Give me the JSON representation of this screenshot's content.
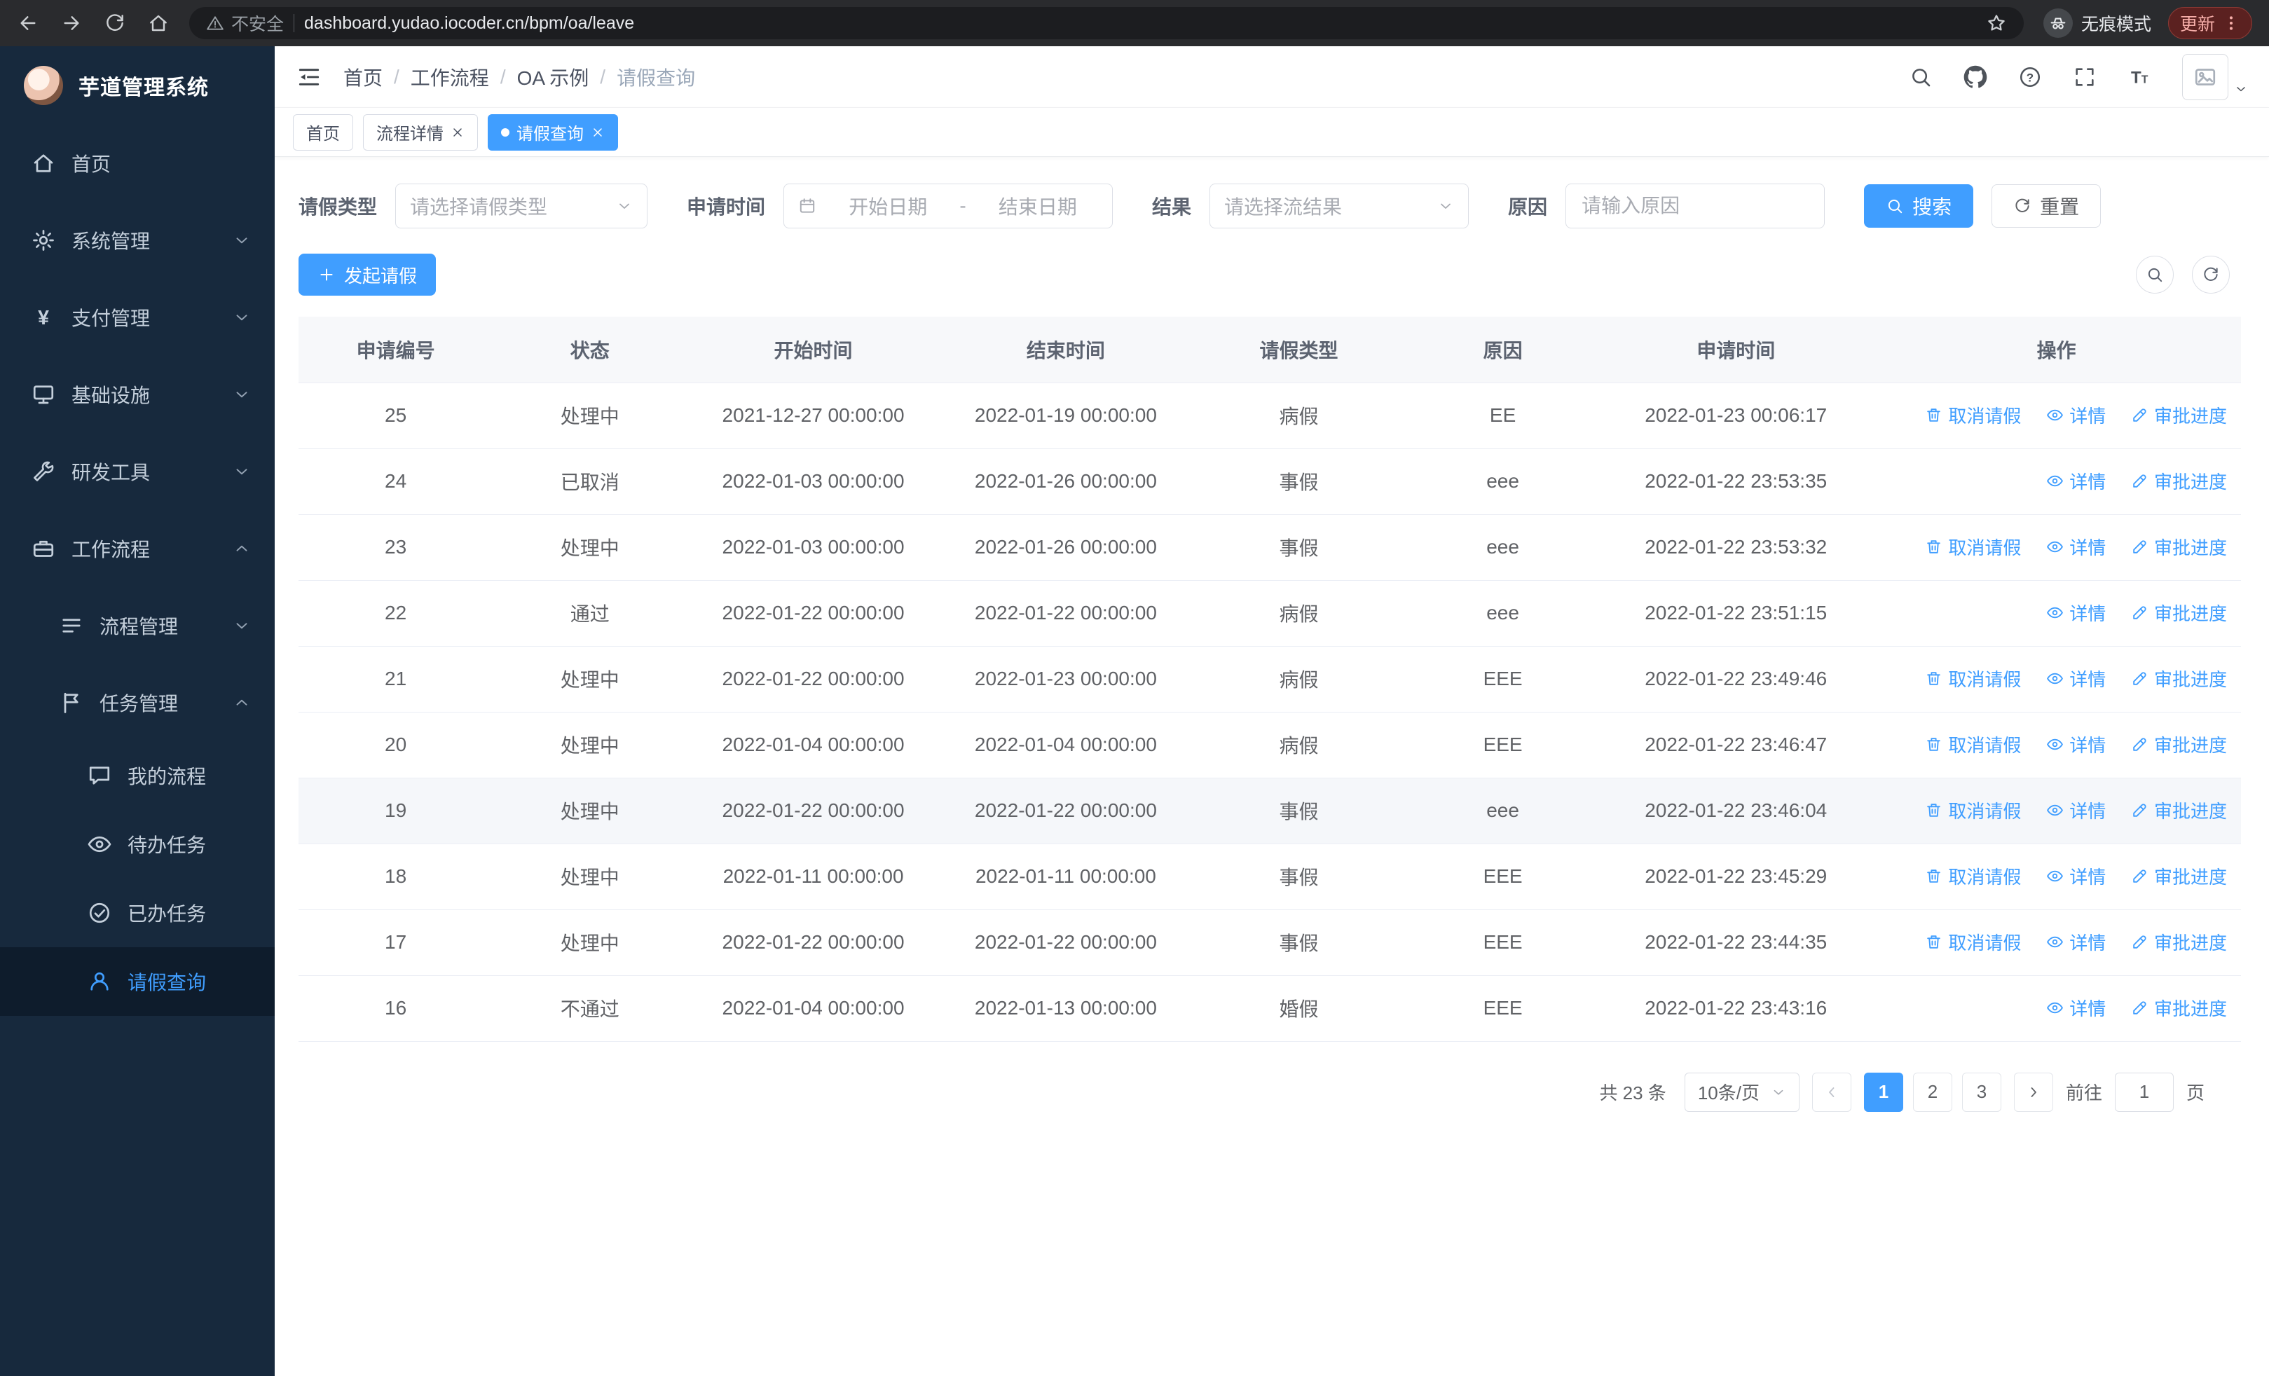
{
  "colors": {
    "primary": "#409eff",
    "sidebar_bg": "#17293d"
  },
  "browser": {
    "security_label": "不安全",
    "url": "dashboard.yudao.iocoder.cn/bpm/oa/leave",
    "incognito_label": "无痕模式",
    "update_label": "更新"
  },
  "sidebar": {
    "logo_title": "芋道管理系统",
    "menu_level1": [
      {
        "label": "首页",
        "icon": "home",
        "has_chevron": false,
        "chevron_up": false,
        "active": false
      },
      {
        "label": "系统管理",
        "icon": "gear",
        "has_chevron": true,
        "chevron_up": false,
        "active": false
      },
      {
        "label": "支付管理",
        "icon": "yen",
        "has_chevron": true,
        "chevron_up": false,
        "active": false
      },
      {
        "label": "基础设施",
        "icon": "infra",
        "has_chevron": true,
        "chevron_up": false,
        "active": false
      },
      {
        "label": "研发工具",
        "icon": "tools",
        "has_chevron": true,
        "chevron_up": false,
        "active": false
      },
      {
        "label": "工作流程",
        "icon": "briefcase",
        "has_chevron": true,
        "chevron_up": true,
        "active": false
      }
    ],
    "menu_level2": [
      {
        "label": "流程管理",
        "icon": "list",
        "has_chevron": true,
        "chevron_up": false,
        "active": false
      },
      {
        "label": "任务管理",
        "icon": "flag",
        "has_chevron": true,
        "chevron_up": true,
        "active": false
      }
    ],
    "menu_level3": [
      {
        "label": "我的流程",
        "icon": "chat",
        "active": false
      },
      {
        "label": "待办任务",
        "icon": "eye",
        "active": false
      },
      {
        "label": "已办任务",
        "icon": "done",
        "active": false
      },
      {
        "label": "请假查询",
        "icon": "user",
        "active": true
      }
    ]
  },
  "header": {
    "breadcrumb": [
      "首页",
      "工作流程",
      "OA 示例",
      "请假查询"
    ]
  },
  "tags": [
    {
      "label": "首页",
      "closable": false,
      "active": false
    },
    {
      "label": "流程详情",
      "closable": true,
      "active": false
    },
    {
      "label": "请假查询",
      "closable": true,
      "active": true
    }
  ],
  "filters": {
    "leave_type_label": "请假类型",
    "leave_type_placeholder": "请选择请假类型",
    "apply_time_label": "申请时间",
    "start_date_placeholder": "开始日期",
    "date_separator": "-",
    "end_date_placeholder": "结束日期",
    "result_label": "结果",
    "result_placeholder": "请选择流结果",
    "reason_label": "原因",
    "reason_placeholder": "请输入原因",
    "search_button": "搜索",
    "reset_button": "重置"
  },
  "toolbar": {
    "create_button": "发起请假"
  },
  "table": {
    "columns": [
      "申请编号",
      "状态",
      "开始时间",
      "结束时间",
      "请假类型",
      "原因",
      "申请时间",
      "操作"
    ],
    "action_labels": {
      "cancel": "取消请假",
      "detail": "详情",
      "progress": "审批进度"
    },
    "rows": [
      {
        "id": "25",
        "status": "处理中",
        "start": "2021-12-27 00:00:00",
        "end": "2022-01-19 00:00:00",
        "type": "病假",
        "reason": "EE",
        "apply_time": "2022-01-23 00:06:17",
        "actions": [
          "cancel",
          "detail",
          "progress"
        ],
        "highlighted": false
      },
      {
        "id": "24",
        "status": "已取消",
        "start": "2022-01-03 00:00:00",
        "end": "2022-01-26 00:00:00",
        "type": "事假",
        "reason": "eee",
        "apply_time": "2022-01-22 23:53:35",
        "actions": [
          "detail",
          "progress"
        ],
        "highlighted": false
      },
      {
        "id": "23",
        "status": "处理中",
        "start": "2022-01-03 00:00:00",
        "end": "2022-01-26 00:00:00",
        "type": "事假",
        "reason": "eee",
        "apply_time": "2022-01-22 23:53:32",
        "actions": [
          "cancel",
          "detail",
          "progress"
        ],
        "highlighted": false
      },
      {
        "id": "22",
        "status": "通过",
        "start": "2022-01-22 00:00:00",
        "end": "2022-01-22 00:00:00",
        "type": "病假",
        "reason": "eee",
        "apply_time": "2022-01-22 23:51:15",
        "actions": [
          "detail",
          "progress"
        ],
        "highlighted": false
      },
      {
        "id": "21",
        "status": "处理中",
        "start": "2022-01-22 00:00:00",
        "end": "2022-01-23 00:00:00",
        "type": "病假",
        "reason": "EEE",
        "apply_time": "2022-01-22 23:49:46",
        "actions": [
          "cancel",
          "detail",
          "progress"
        ],
        "highlighted": false
      },
      {
        "id": "20",
        "status": "处理中",
        "start": "2022-01-04 00:00:00",
        "end": "2022-01-04 00:00:00",
        "type": "病假",
        "reason": "EEE",
        "apply_time": "2022-01-22 23:46:47",
        "actions": [
          "cancel",
          "detail",
          "progress"
        ],
        "highlighted": false
      },
      {
        "id": "19",
        "status": "处理中",
        "start": "2022-01-22 00:00:00",
        "end": "2022-01-22 00:00:00",
        "type": "事假",
        "reason": "eee",
        "apply_time": "2022-01-22 23:46:04",
        "actions": [
          "cancel",
          "detail",
          "progress"
        ],
        "highlighted": true
      },
      {
        "id": "18",
        "status": "处理中",
        "start": "2022-01-11 00:00:00",
        "end": "2022-01-11 00:00:00",
        "type": "事假",
        "reason": "EEE",
        "apply_time": "2022-01-22 23:45:29",
        "actions": [
          "cancel",
          "detail",
          "progress"
        ],
        "highlighted": false
      },
      {
        "id": "17",
        "status": "处理中",
        "start": "2022-01-22 00:00:00",
        "end": "2022-01-22 00:00:00",
        "type": "事假",
        "reason": "EEE",
        "apply_time": "2022-01-22 23:44:35",
        "actions": [
          "cancel",
          "detail",
          "progress"
        ],
        "highlighted": false
      },
      {
        "id": "16",
        "status": "不通过",
        "start": "2022-01-04 00:00:00",
        "end": "2022-01-13 00:00:00",
        "type": "婚假",
        "reason": "EEE",
        "apply_time": "2022-01-22 23:43:16",
        "actions": [
          "detail",
          "progress"
        ],
        "highlighted": false
      }
    ]
  },
  "pagination": {
    "total_text": "共 23 条",
    "page_size": "10条/页",
    "pages": [
      {
        "label": "1",
        "active": true
      },
      {
        "label": "2",
        "active": false
      },
      {
        "label": "3",
        "active": false
      }
    ],
    "goto_label": "前往",
    "goto_value": "1",
    "page_unit": "页"
  }
}
